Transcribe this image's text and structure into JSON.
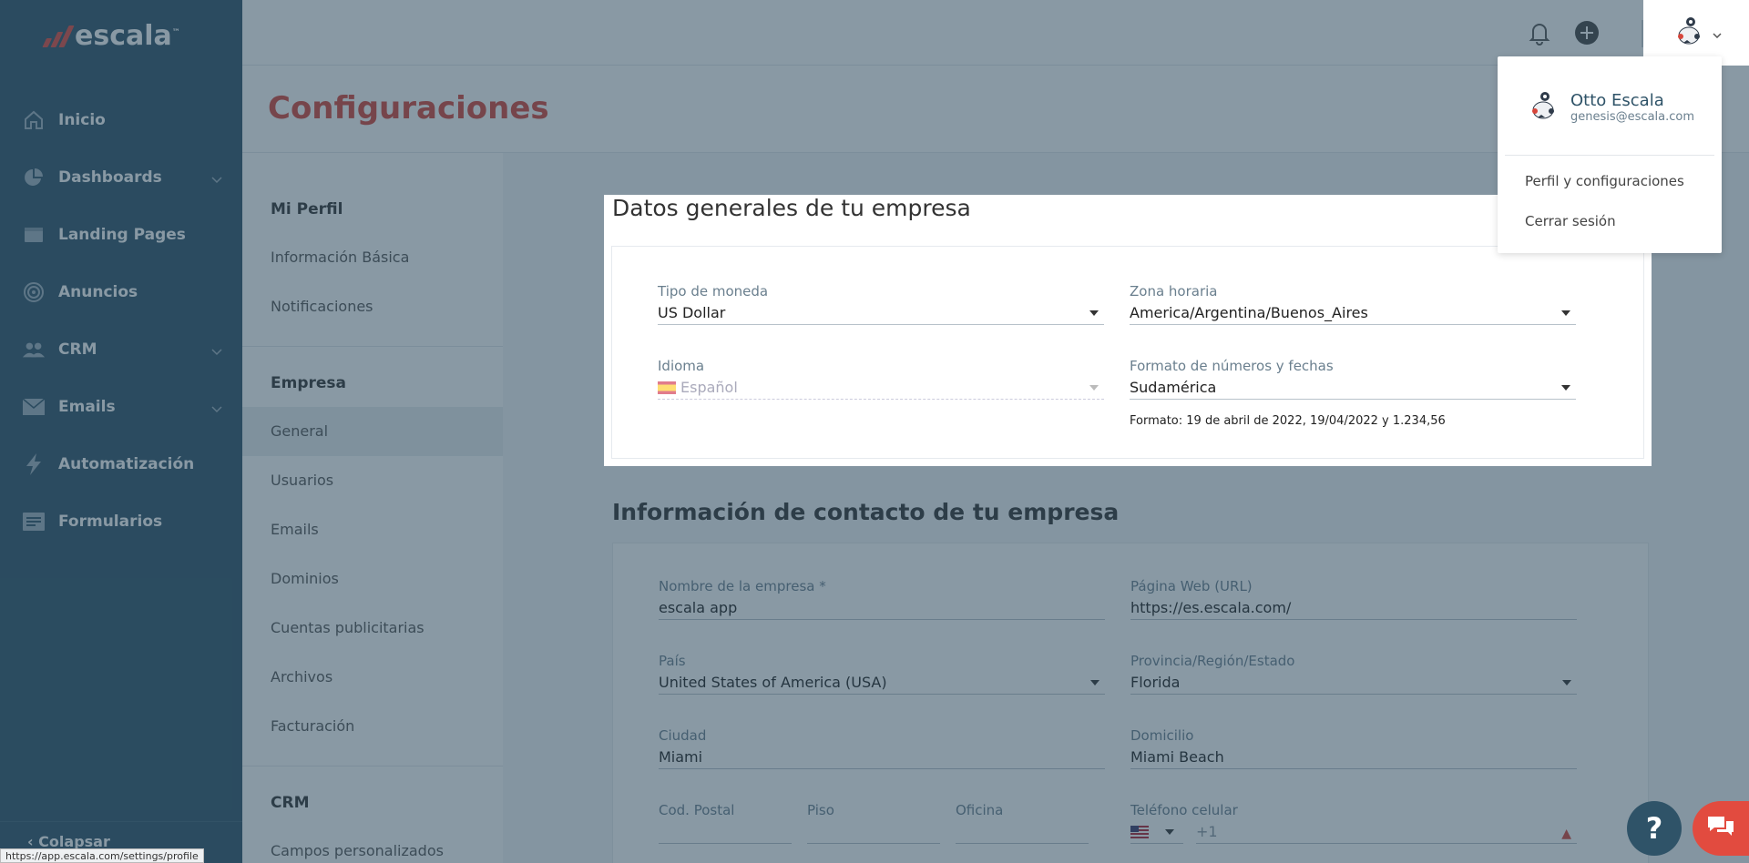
{
  "brand": {
    "name": "escala",
    "tm": "™",
    "color": "#e24b3f"
  },
  "sidebar": {
    "bg": "#2f5368",
    "items": [
      {
        "label": "Inicio",
        "icon": "home-icon",
        "has_chevron": false
      },
      {
        "label": "Dashboards",
        "icon": "pie-chart-icon",
        "has_chevron": true
      },
      {
        "label": "Landing Pages",
        "icon": "browser-window-icon",
        "has_chevron": false
      },
      {
        "label": "Anuncios",
        "icon": "target-icon",
        "has_chevron": false
      },
      {
        "label": "CRM",
        "icon": "people-icon",
        "has_chevron": true
      },
      {
        "label": "Emails",
        "icon": "envelope-icon",
        "has_chevron": true
      },
      {
        "label": "Automatización",
        "icon": "lightning-icon",
        "has_chevron": false
      },
      {
        "label": "Formularios",
        "icon": "form-icon",
        "has_chevron": false
      }
    ],
    "collapse_label": "Colapsar"
  },
  "status_url": "https://app.escala.com/settings/profile",
  "page": {
    "title": "Configuraciones",
    "title_color": "#d6453a"
  },
  "settings_menu": {
    "sections": [
      {
        "title": "Mi Perfil",
        "items": [
          "Información Básica",
          "Notificaciones"
        ]
      },
      {
        "title": "Empresa",
        "items": [
          "General",
          "Usuarios",
          "Emails",
          "Dominios",
          "Cuentas publicitarias",
          "Archivos",
          "Facturación"
        ]
      },
      {
        "title": "CRM",
        "items": [
          "Campos personalizados"
        ]
      }
    ],
    "active_item": "General"
  },
  "general": {
    "title": "Datos generales de tu empresa",
    "currency": {
      "label": "Tipo de moneda",
      "value": "US Dollar"
    },
    "timezone": {
      "label": "Zona horaria",
      "value": "America/Argentina/Buenos_Aires"
    },
    "language": {
      "label": "Idioma",
      "value": "Español",
      "flag": "spain-flag-icon"
    },
    "format": {
      "label": "Formato de números y fechas",
      "value": "Sudamérica",
      "hint": "Formato: 19 de abril de 2022, 19/04/2022 y 1.234,56"
    }
  },
  "contact": {
    "title": "Información de contacto de tu empresa",
    "company_name": {
      "label": "Nombre de la empresa *",
      "value": "escala app"
    },
    "website": {
      "label": "Página Web (URL)",
      "value": "https://es.escala.com/"
    },
    "country": {
      "label": "País",
      "value": "United States of America (USA)"
    },
    "state": {
      "label": "Provincia/Región/Estado",
      "value": "Florida"
    },
    "city": {
      "label": "Ciudad",
      "value": "Miami"
    },
    "address": {
      "label": "Domicilio",
      "value": "Miami Beach"
    },
    "postal": {
      "label": "Cod. Postal",
      "value": ""
    },
    "floor": {
      "label": "Piso",
      "value": ""
    },
    "office": {
      "label": "Oficina",
      "value": ""
    },
    "phone": {
      "label": "Teléfono celular",
      "value": "+1",
      "flag": "usa-flag-icon"
    }
  },
  "user": {
    "name": "Otto Escala",
    "email": "genesis@escala.com",
    "menu": [
      "Perfil y configuraciones",
      "Cerrar sesión"
    ]
  },
  "help_label": "?"
}
